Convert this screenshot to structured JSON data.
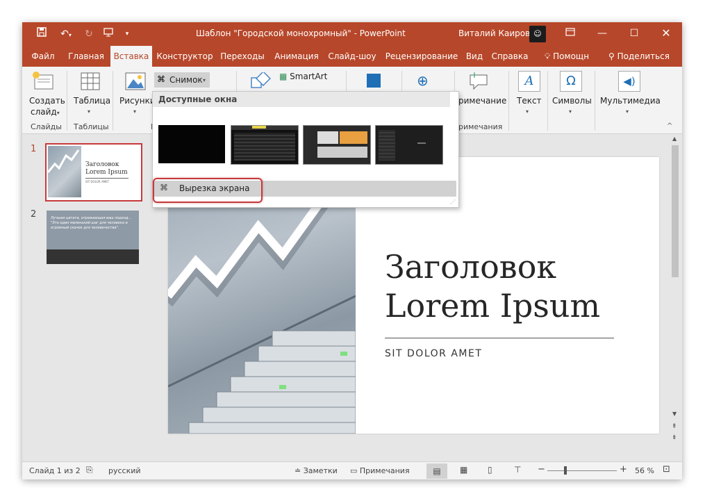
{
  "window": {
    "title": "Шаблон \"Городской монохромный\"  -  PowerPoint",
    "user": "Виталий Каиров"
  },
  "tabs": [
    "Файл",
    "Главная",
    "Вставка",
    "Конструктор",
    "Переходы",
    "Анимация",
    "Слайд-шоу",
    "Рецензирование",
    "Вид",
    "Справка"
  ],
  "tabs_extra": {
    "help_search": "Помощн",
    "share": "Поделиться"
  },
  "ribbon": {
    "new_slide_line1": "Создать",
    "new_slide_line2": "слайд",
    "slides_group": "Слайды",
    "table_label": "Таблица",
    "tables_group": "Таблицы",
    "pictures_label": "Рисунки",
    "images_group_partial": "И",
    "snapshot_label": "Снимок",
    "smartart_label": "SmartArt",
    "comment_label": "римечание",
    "comments_group": "римечания",
    "text_label": "Текст",
    "symbols_label": "Символы",
    "media_label": "Мультимедиа"
  },
  "screenshot_menu": {
    "header": "Доступные окна",
    "clipping_label": "Вырезка экрана"
  },
  "slide_thumbnails": [
    {
      "number": "1",
      "title": "Заголовок Lorem Ipsum",
      "subtitle": "SIT DOLOR AMET"
    },
    {
      "number": "2",
      "quote": "Лучшая цитата, отражающая ваш подход... \"Это один маленький шаг для человека и огромный скачок для человечества\"."
    }
  ],
  "slide": {
    "title": "Заголовок Lorem Ipsum",
    "subtitle": "SIT DOLOR AMET"
  },
  "status_bar": {
    "slide_counter": "Слайд 1 из 2",
    "language": "русский",
    "notes": "Заметки",
    "comments": "Примечания",
    "zoom": "56 %"
  },
  "colors": {
    "accent": "#b7472a",
    "highlight": "#c6393c"
  }
}
